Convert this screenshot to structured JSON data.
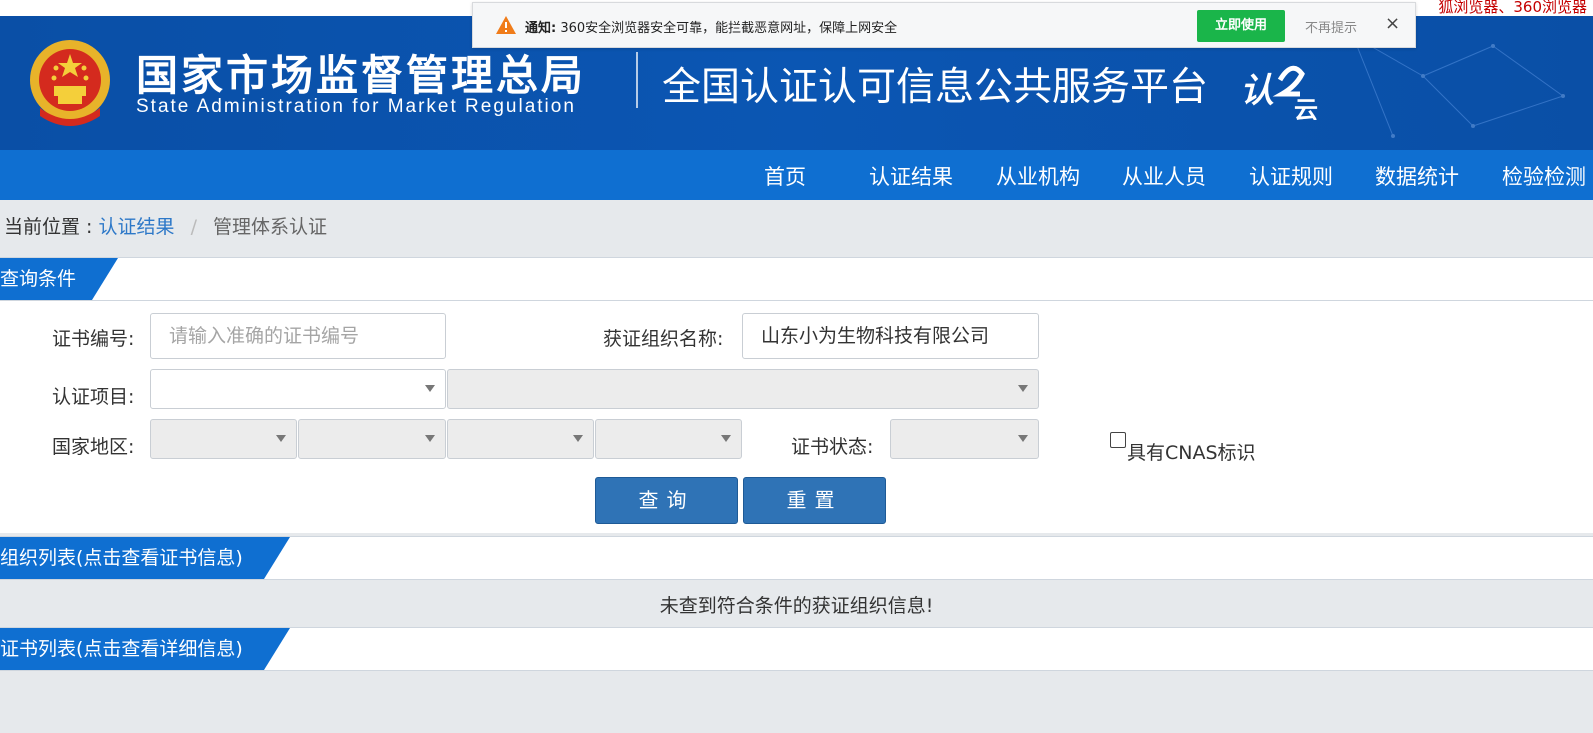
{
  "top_strip": {
    "text": "狐浏览器、360浏览器"
  },
  "notification": {
    "prefix": "通知:",
    "message": "360安全浏览器安全可靠，能拦截恶意网址，保障上网安全",
    "use_button": "立即使用",
    "dismiss": "不再提示",
    "close": "×"
  },
  "header": {
    "org_cn": "国家市场监督管理总局",
    "org_en": "State Administration  for  Market Regulation",
    "platform_title": "全国认证认可信息公共服务平台",
    "logo_text_main": "认",
    "logo_text_sub": "云"
  },
  "nav": {
    "items": [
      "首页",
      "认证结果",
      "从业机构",
      "从业人员",
      "认证规则",
      "数据统计",
      "检验检测"
    ]
  },
  "breadcrumb": {
    "label": "当前位置 :",
    "link": "认证结果",
    "separator": "/",
    "current": "管理体系认证"
  },
  "query_section": {
    "title": "查询条件"
  },
  "form": {
    "cert_no_label": "证书编号:",
    "cert_no_placeholder": "请输入准确的证书编号",
    "org_name_label": "获证组织名称:",
    "org_name_value": "山东小为生物科技有限公司",
    "project_label": "认证项目:",
    "region_label": "国家地区:",
    "status_label": "证书状态:",
    "cnas_label": "具有CNAS标识",
    "query_button": "查询",
    "reset_button": "重置"
  },
  "org_list_section": {
    "title": "组织列表(点击查看证书信息)"
  },
  "org_list_empty": "未查到符合条件的获证组织信息!",
  "cert_list_section": {
    "title": "证书列表(点击查看详细信息)"
  },
  "colors": {
    "header_blue": "#0b56b3",
    "nav_blue": "#0f6fd1",
    "button_blue": "#2f73b6",
    "notice_green": "#1ab54a",
    "link_blue": "#2d78c8"
  }
}
